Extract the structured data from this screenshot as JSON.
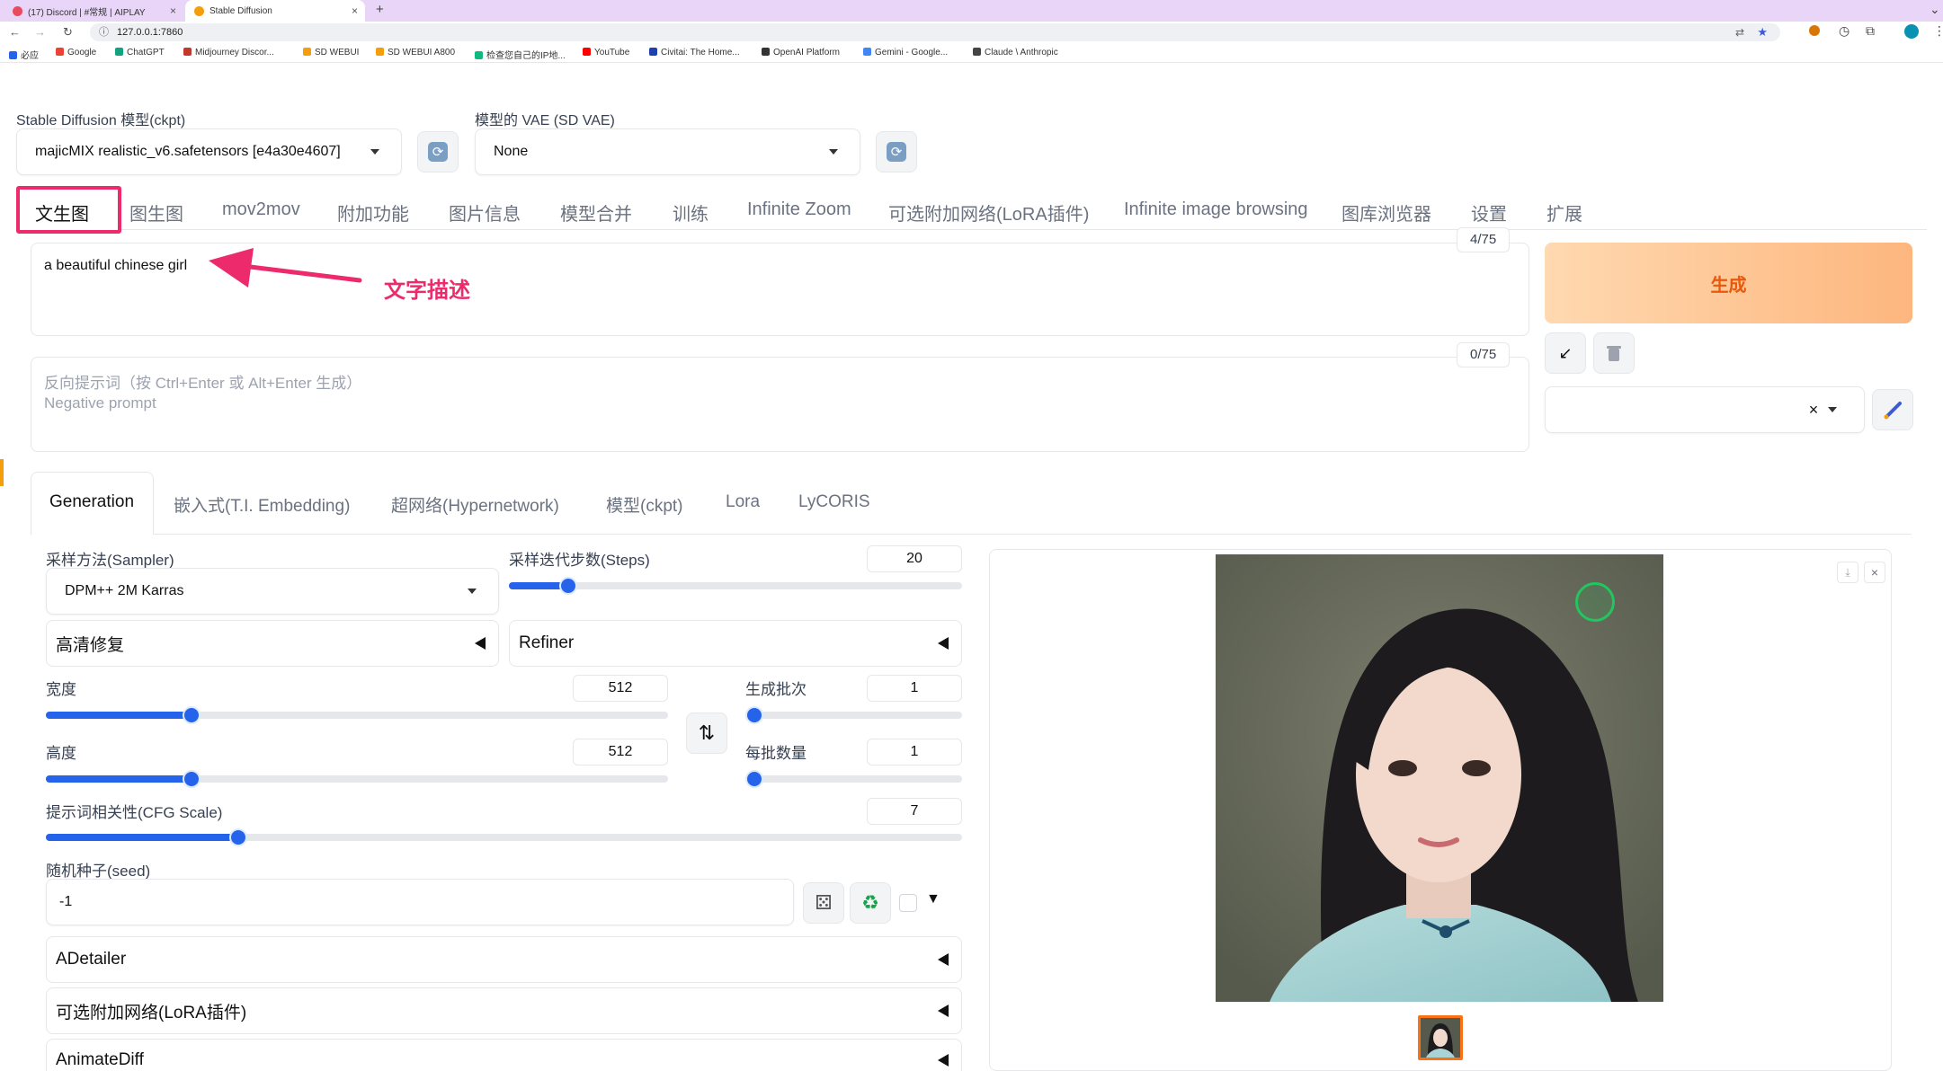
{
  "browser": {
    "tabs": [
      {
        "title": "(17) Discord | #常规 | AIPLAY",
        "active": false
      },
      {
        "title": "Stable Diffusion",
        "active": true
      }
    ],
    "new_tab": "+",
    "url": "127.0.0.1:7860",
    "bookmarks": [
      "必应",
      "Google",
      "ChatGPT",
      "Midjourney Discor...",
      "SD WEBUI",
      "SD WEBUI A800",
      "检查您自己的IP地...",
      "YouTube",
      "Civitai: The Home...",
      "OpenAI Platform",
      "Gemini - Google...",
      "Claude \\ Anthropic"
    ]
  },
  "model_select": {
    "label": "Stable Diffusion 模型(ckpt)",
    "value": "majicMIX realistic_v6.safetensors [e4a30e4607]"
  },
  "vae_select": {
    "label": "模型的 VAE (SD VAE)",
    "value": "None"
  },
  "main_tabs": [
    "文生图",
    "图生图",
    "mov2mov",
    "附加功能",
    "图片信息",
    "模型合并",
    "训练",
    "Infinite Zoom",
    "可选附加网络(LoRA插件)",
    "Infinite image browsing",
    "图库浏览器",
    "设置",
    "扩展"
  ],
  "prompt": {
    "value": "a beautiful chinese girl",
    "counter": "4/75",
    "annotation": "文字描述"
  },
  "negative_prompt": {
    "placeholder_line1": "反向提示词（按 Ctrl+Enter 或 Alt+Enter 生成）",
    "placeholder_line2": "Negative prompt",
    "counter": "0/75"
  },
  "generate_label": "生成",
  "sub_tabs": [
    "Generation",
    "嵌入式(T.I. Embedding)",
    "超网络(Hypernetwork)",
    "模型(ckpt)",
    "Lora",
    "LyCORIS"
  ],
  "sampler": {
    "label": "采样方法(Sampler)",
    "value": "DPM++ 2M Karras"
  },
  "steps": {
    "label": "采样迭代步数(Steps)",
    "value": "20",
    "fraction": 0.13
  },
  "hires": {
    "label": "高清修复"
  },
  "refiner": {
    "label": "Refiner"
  },
  "width": {
    "label": "宽度",
    "value": "512",
    "fraction": 0.234
  },
  "height": {
    "label": "高度",
    "value": "512",
    "fraction": 0.234
  },
  "batch_count": {
    "label": "生成批次",
    "value": "1",
    "fraction": 0.0
  },
  "batch_size": {
    "label": "每批数量",
    "value": "1",
    "fraction": 0.0
  },
  "cfg": {
    "label": "提示词相关性(CFG Scale)",
    "value": "7",
    "fraction": 0.21
  },
  "seed": {
    "label": "随机种子(seed)",
    "value": "-1"
  },
  "accordions": [
    "ADetailer",
    "可选附加网络(LoRA插件)",
    "AnimateDiff"
  ],
  "colors": {
    "accent": "#2563eb",
    "highlight": "#ec2a6c",
    "generate_text": "#ea580c"
  }
}
